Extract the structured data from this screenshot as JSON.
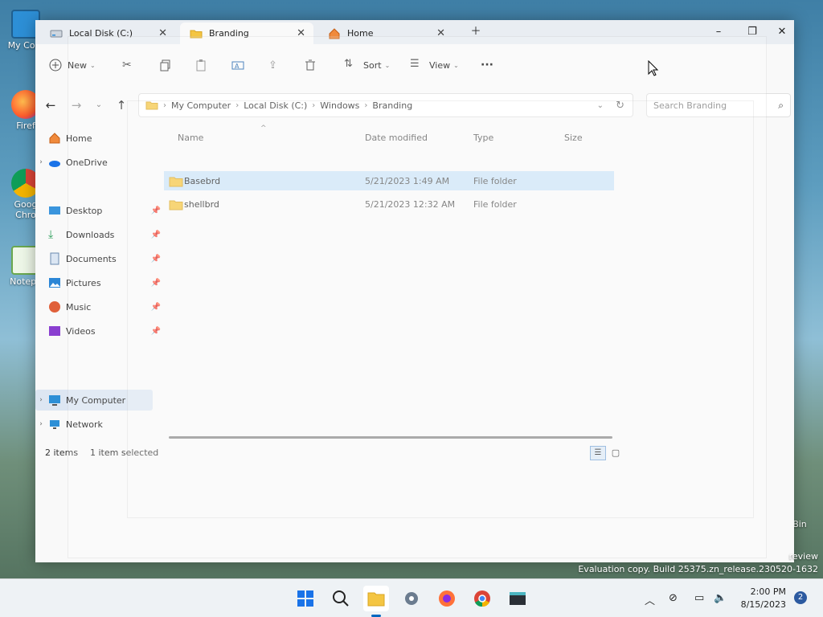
{
  "desktop": {
    "icons": [
      {
        "label": "My Com"
      },
      {
        "label": "Firef"
      },
      {
        "label": "Goog Chro"
      },
      {
        "label": "Notepa"
      },
      {
        "label": "Bin"
      }
    ]
  },
  "explorer": {
    "tabs": [
      {
        "label": "Local Disk (C:)",
        "icon": "drive-icon"
      },
      {
        "label": "Branding",
        "icon": "folder-icon"
      },
      {
        "label": "Home",
        "icon": "home-icon"
      }
    ],
    "toolbar": {
      "new_label": "New",
      "sort_label": "Sort",
      "view_label": "View",
      "more_label": "···"
    },
    "address": {
      "crumbs": [
        "My Computer",
        "Local Disk (C:)",
        "Windows",
        "Branding"
      ],
      "search_placeholder": "Search Branding"
    },
    "nav": {
      "items": [
        {
          "label": "Home"
        },
        {
          "label": "OneDrive"
        },
        {
          "label": "Desktop"
        },
        {
          "label": "Downloads"
        },
        {
          "label": "Documents"
        },
        {
          "label": "Pictures"
        },
        {
          "label": "Music"
        },
        {
          "label": "Videos"
        },
        {
          "label": "My Computer"
        },
        {
          "label": "Network"
        }
      ]
    },
    "columns": {
      "name": "Name",
      "date": "Date modified",
      "type": "Type",
      "size": "Size"
    },
    "files": [
      {
        "name": "Basebrd",
        "date": "5/21/2023 1:49 AM",
        "type": "File folder",
        "size": ""
      },
      {
        "name": "shellbrd",
        "date": "5/21/2023 12:32 AM",
        "type": "File folder",
        "size": ""
      }
    ],
    "status": {
      "count": "2 items",
      "selected": "1 item selected"
    }
  },
  "watermark": {
    "line1": "review",
    "line2": "Evaluation copy. Build 25375.zn_release.230520-1632"
  },
  "taskbar": {
    "time": "2:00 PM",
    "date": "8/15/2023",
    "notification_count": "2"
  },
  "colors": {
    "accent": "#0067c0",
    "folder": "#f4c542",
    "selection": "#cce4f7"
  }
}
